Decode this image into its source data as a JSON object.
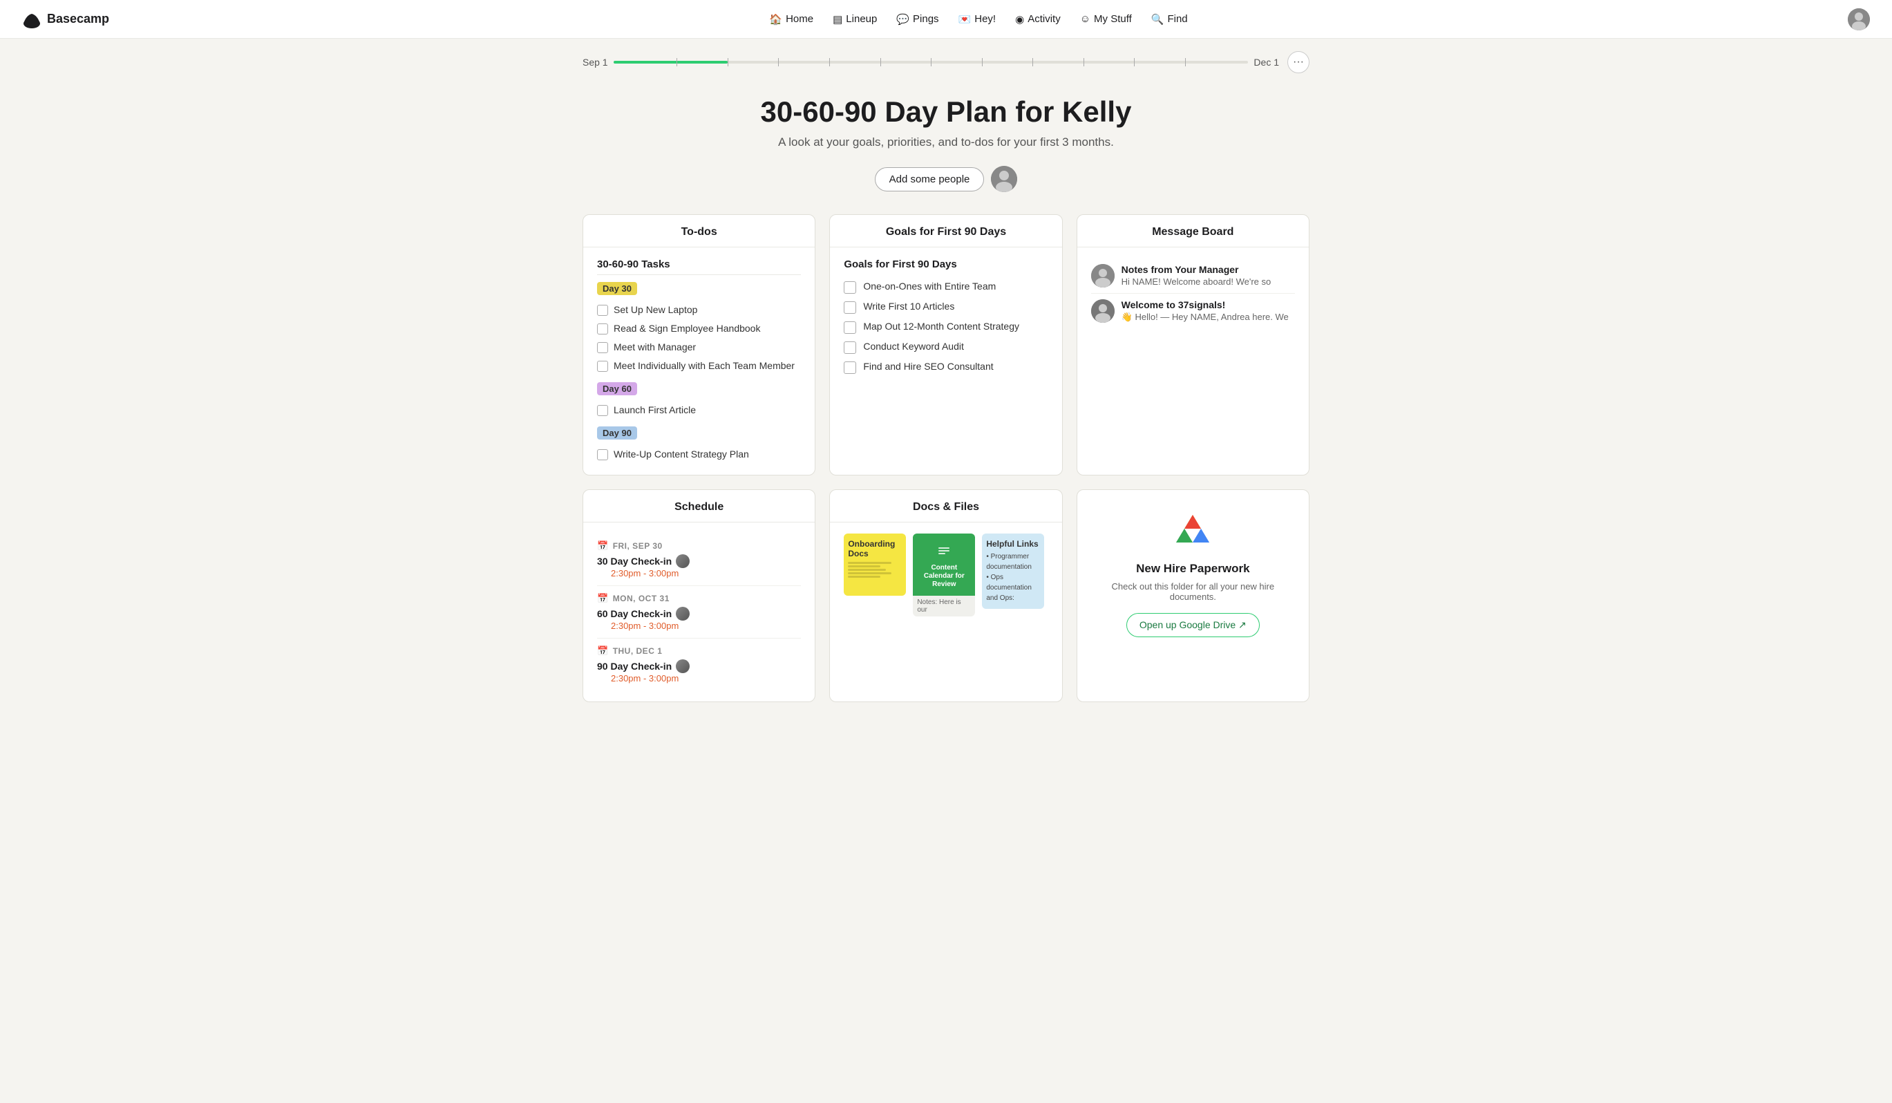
{
  "nav": {
    "logo_text": "Basecamp",
    "links": [
      {
        "label": "Home",
        "icon": "🏠",
        "name": "home"
      },
      {
        "label": "Lineup",
        "icon": "▤",
        "name": "lineup"
      },
      {
        "label": "Pings",
        "icon": "💬",
        "name": "pings"
      },
      {
        "label": "Hey!",
        "icon": "💌",
        "name": "hey"
      },
      {
        "label": "Activity",
        "icon": "◉",
        "name": "activity"
      },
      {
        "label": "My Stuff",
        "icon": "☺",
        "name": "mystuff"
      },
      {
        "label": "Find",
        "icon": "🔍",
        "name": "find"
      }
    ]
  },
  "timeline": {
    "start_label": "Sep 1",
    "end_label": "Dec 1"
  },
  "hero": {
    "title": "30-60-90 Day Plan for Kelly",
    "subtitle": "A look at your goals, priorities, and to-dos for your first 3 months.",
    "add_people_label": "Add some people"
  },
  "todos_card": {
    "header": "To-dos",
    "section_title": "30-60-90 Tasks",
    "groups": [
      {
        "label": "Day 30",
        "class": "day30",
        "items": [
          "Set Up New Laptop",
          "Read & Sign Employee Handbook",
          "Meet with Manager",
          "Meet Individually with Each Team Member"
        ]
      },
      {
        "label": "Day 60",
        "class": "day60",
        "items": [
          "Launch First Article"
        ]
      },
      {
        "label": "Day 90",
        "class": "day90",
        "items": [
          "Write-Up Content Strategy Plan"
        ]
      }
    ]
  },
  "goals_card": {
    "header": "Goals for First 90 Days",
    "section_title": "Goals for First 90 Days",
    "items": [
      "One-on-Ones with Entire Team",
      "Write First 10 Articles",
      "Map Out 12-Month Content Strategy",
      "Conduct Keyword Audit",
      "Find and Hire SEO Consultant"
    ]
  },
  "messages_card": {
    "header": "Message Board",
    "messages": [
      {
        "title": "Notes from Your Manager",
        "preview": "Hi NAME! Welcome aboard! We're so"
      },
      {
        "title": "Welcome to 37signals!",
        "preview": "👋 Hello! — Hey NAME, Andrea here. We"
      }
    ]
  },
  "schedule_card": {
    "header": "Schedule",
    "events": [
      {
        "date": "FRI, SEP 30",
        "cal_color": "#e05c2a",
        "event": "30 Day Check-in",
        "time": "2:30pm - 3:00pm"
      },
      {
        "date": "MON, OCT 31",
        "cal_color": "#e05c2a",
        "event": "60 Day Check-in",
        "time": "2:30pm - 3:00pm"
      },
      {
        "date": "THU, DEC 1",
        "cal_color": "#4a90d9",
        "event": "90 Day Check-in",
        "time": "2:30pm - 3:00pm"
      }
    ]
  },
  "docs_card": {
    "header": "Docs & Files",
    "docs": [
      {
        "title": "Onboarding Docs",
        "type": "yellow",
        "subtitle": ""
      },
      {
        "title": "Content Calendar for Review",
        "type": "green",
        "subtitle": "Notes: Here is our"
      },
      {
        "title": "Helpful Links",
        "type": "blue",
        "subtitle": "• Programmer documentation • Ops documentation and Ops:"
      }
    ]
  },
  "gdrive_card": {
    "title": "New Hire Paperwork",
    "description": "Check out this folder for all your new hire documents.",
    "button_label": "Open up Google Drive ↗"
  }
}
